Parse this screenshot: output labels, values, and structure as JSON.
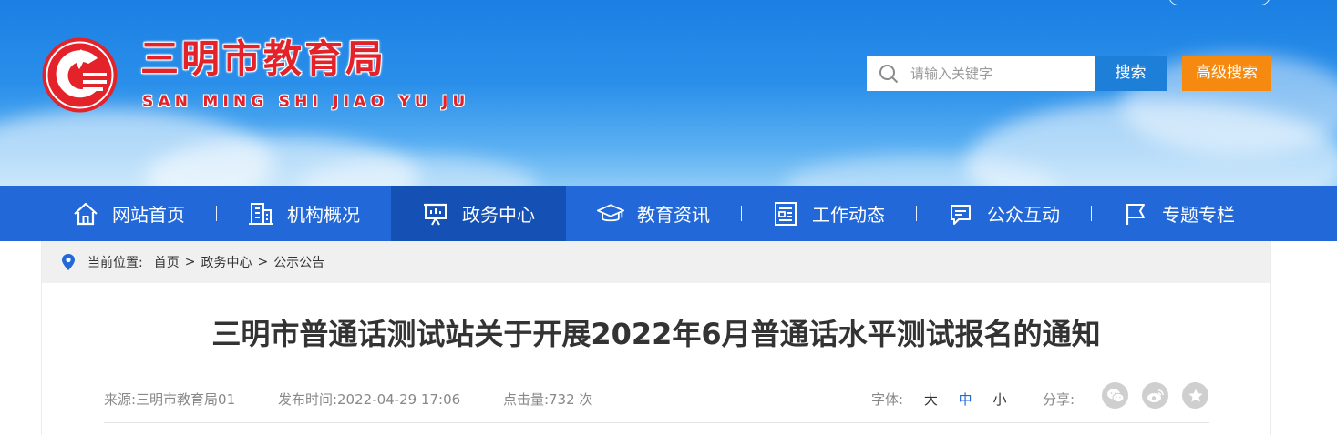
{
  "header": {
    "site_title": "三明市教育局",
    "site_subtitle": "SAN MING SHI JIAO YU JU",
    "search": {
      "placeholder": "请输入关键字",
      "value": "",
      "search_label": "搜索",
      "advanced_label": "高级搜索"
    }
  },
  "nav": {
    "items": [
      {
        "label": "网站首页",
        "icon": "home-icon"
      },
      {
        "label": "机构概况",
        "icon": "building-icon"
      },
      {
        "label": "政务中心",
        "icon": "presentation-board-icon",
        "active": true
      },
      {
        "label": "教育资讯",
        "icon": "graduation-cap-icon"
      },
      {
        "label": "工作动态",
        "icon": "document-list-icon"
      },
      {
        "label": "公众互动",
        "icon": "chat-bubble-icon"
      },
      {
        "label": "专题专栏",
        "icon": "flag-icon"
      }
    ]
  },
  "breadcrumb": {
    "label": "当前位置:",
    "items": [
      "首页",
      "政务中心",
      "公示公告"
    ],
    "separator": ">"
  },
  "article": {
    "title": "三明市普通话测试站关于开展2022年6月普通话水平测试报名的通知",
    "source": "来源:三明市教育局01",
    "published": "发布时间:2022-04-29 17:06",
    "clicks": "点击量:732 次",
    "font_size": {
      "label": "字体:",
      "options": [
        "大",
        "中",
        "小"
      ],
      "selected": "中"
    },
    "share": {
      "label": "分享:",
      "targets": [
        "wechat-icon",
        "weibo-icon",
        "favorite-star-icon"
      ]
    }
  },
  "colors": {
    "brand_red": "#e3222a",
    "nav_blue": "#2268d8",
    "nav_active": "#1550b4",
    "search_blue": "#1e7fd9",
    "advanced_orange": "#f68a10"
  }
}
